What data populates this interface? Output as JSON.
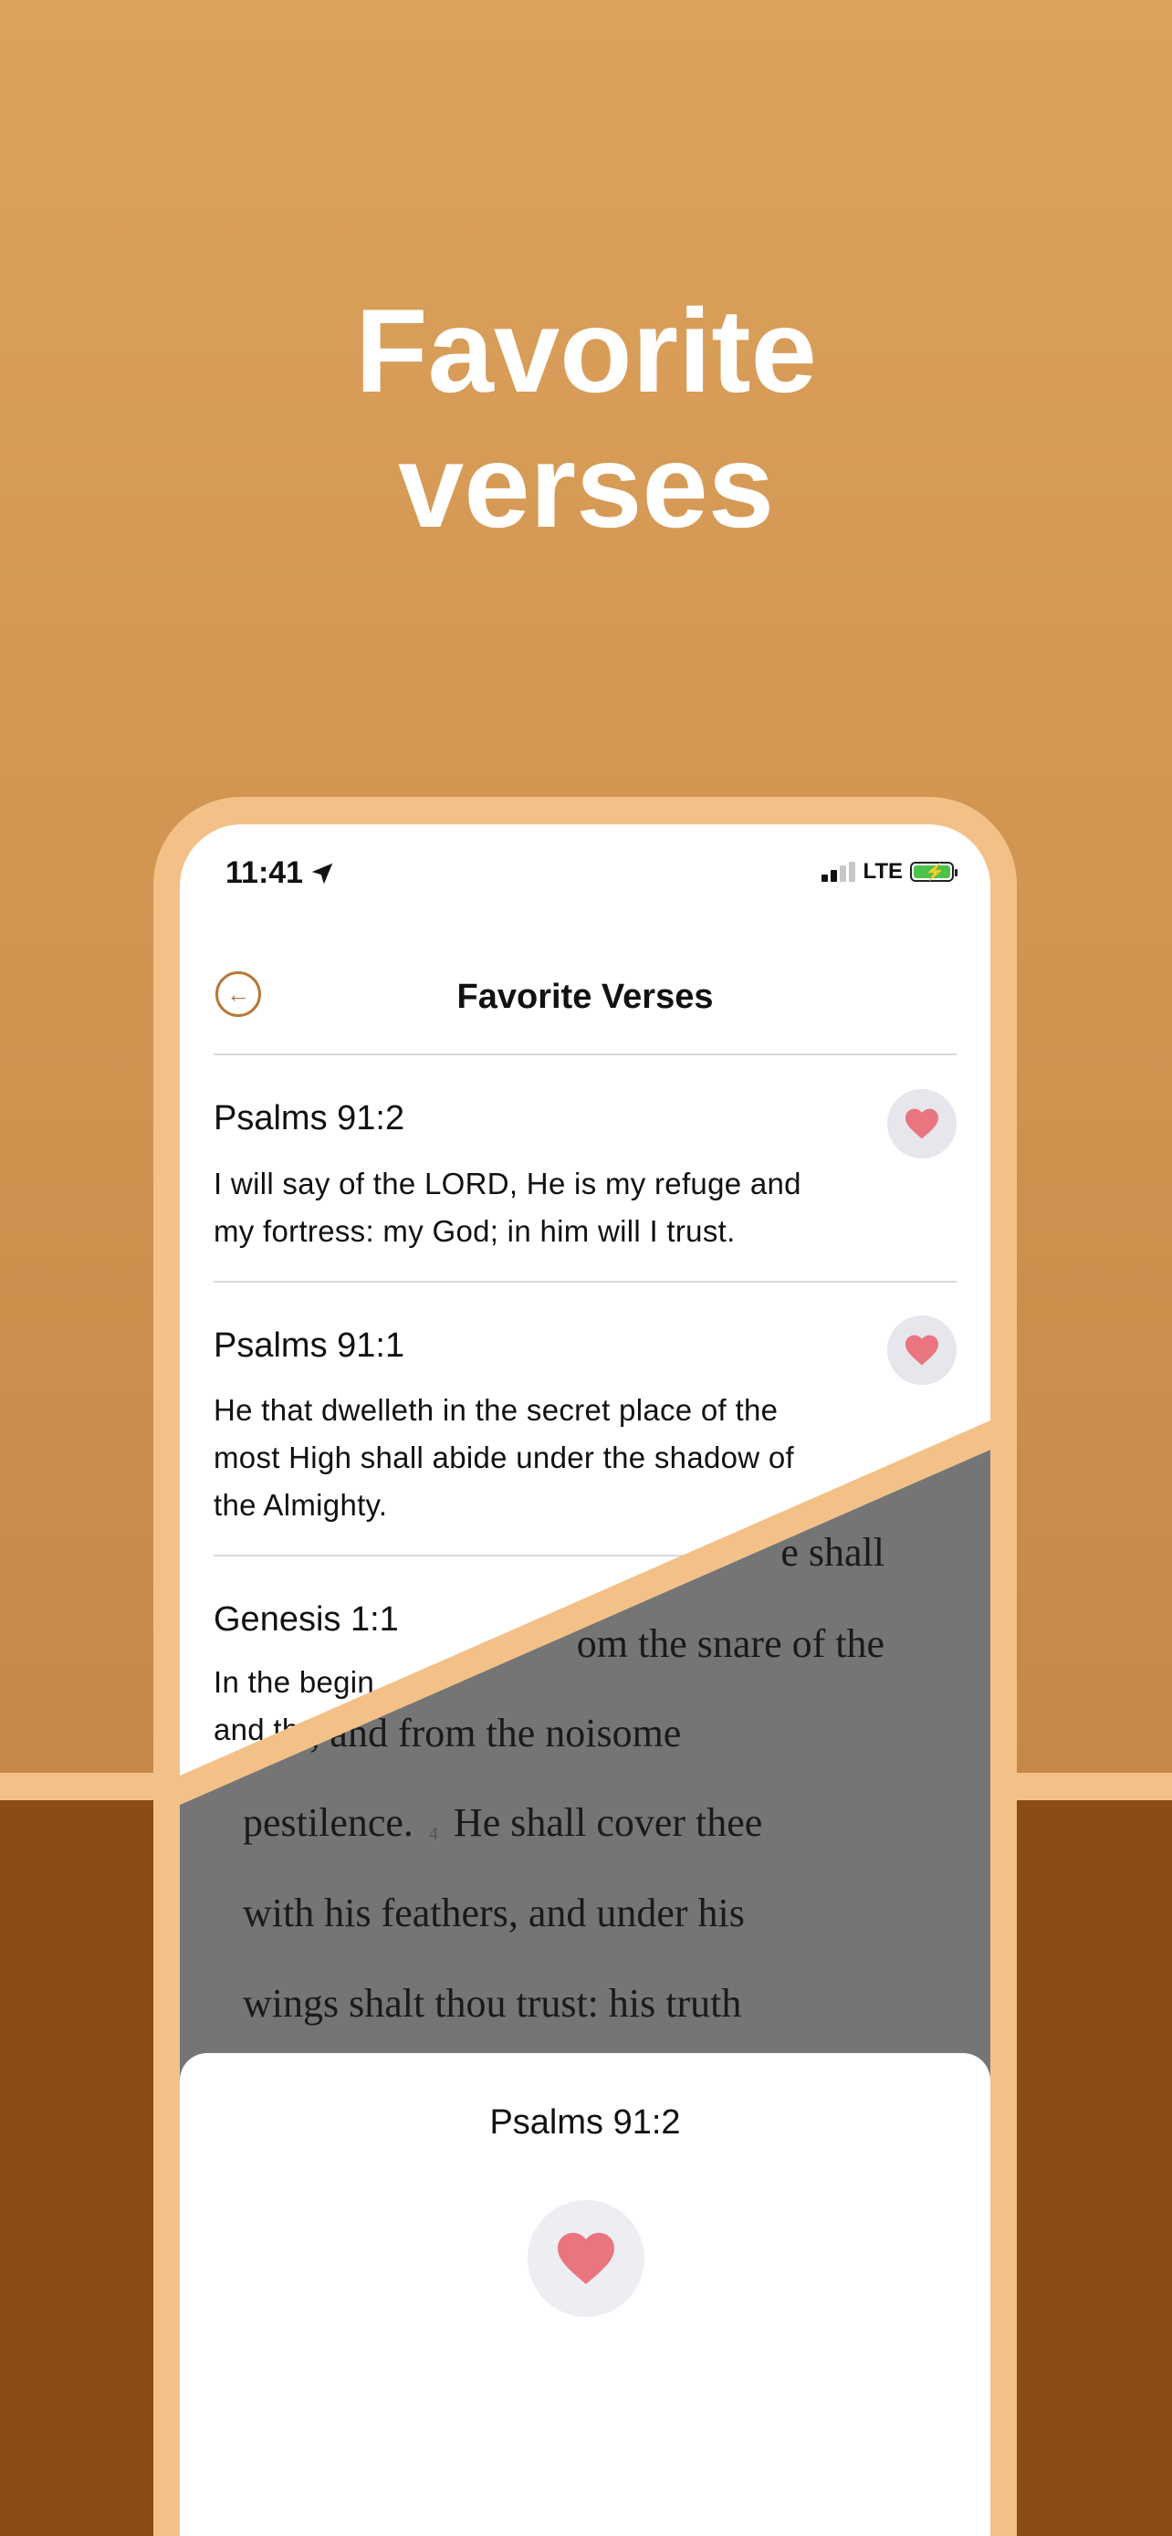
{
  "headline": {
    "line1": "Favorite",
    "line2": "verses"
  },
  "status_bar": {
    "time": "11:41",
    "network": "LTE"
  },
  "nav": {
    "title": "Favorite Verses"
  },
  "verses": [
    {
      "ref": "Psalms 91:2",
      "lines": [
        "I will say of the LORD, He is my refuge and",
        "my fortress: my God; in him will I trust."
      ]
    },
    {
      "ref": "Psalms 91:1",
      "lines": [
        "He that dwelleth in the secret place of the",
        "most High shall abide under the shadow of",
        "the Almighty."
      ]
    },
    {
      "ref": "Genesis 1:1",
      "lines": [
        "In the begin",
        "and th"
      ]
    }
  ],
  "reader": {
    "lines": [
      "e shall",
      "om the snare of the",
      "er, and from the noisome",
      "pestilence.",
      "He shall cover thee",
      "with his feathers, and under his",
      "wings shalt thou trust: his truth"
    ],
    "verse_number": "4"
  },
  "sheet": {
    "title": "Psalms 91:2"
  },
  "colors": {
    "accent": "#b8763a",
    "heart": "#e8757f",
    "bg_top": "#dca25c",
    "bg_bottom": "#8d4b15",
    "frame": "#f3c188"
  },
  "icons": {
    "back": "arrow-left-circle-icon",
    "favorite": "heart-icon",
    "location": "location-arrow-icon"
  }
}
